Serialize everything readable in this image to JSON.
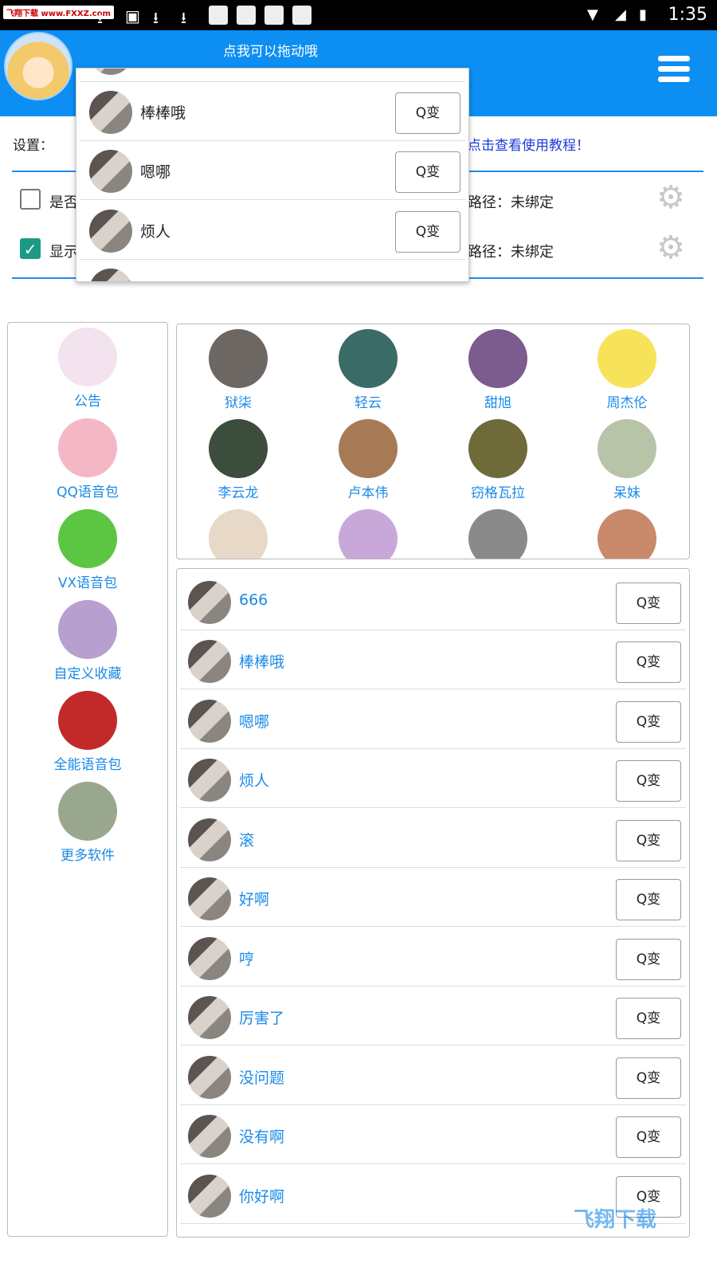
{
  "status_bar": {
    "watermark": "飞翔下载 www.FXXZ.com",
    "time": "1:35"
  },
  "header": {
    "hint": "点我可以拖动哦"
  },
  "settings": {
    "label": "设置：",
    "tutorial_link": "点击查看使用教程！",
    "row1": {
      "label": "是否",
      "path": "路径：未绑定",
      "checked": false
    },
    "row2": {
      "label": "显示",
      "path": "路径：未绑定",
      "checked": true
    }
  },
  "popup": {
    "items": [
      {
        "name": "棒棒哦",
        "button": "Q变"
      },
      {
        "name": "嗯哪",
        "button": "Q变"
      },
      {
        "name": "烦人",
        "button": "Q变"
      }
    ]
  },
  "categories": [
    {
      "label": "公告",
      "color": "#f3e3ee"
    },
    {
      "label": "QQ语音包",
      "color": "#f4b7c6"
    },
    {
      "label": "VX语音包",
      "color": "#5cc642"
    },
    {
      "label": "自定义收藏",
      "color": "#b7a0cf"
    },
    {
      "label": "全能语音包",
      "color": "#c22a2a"
    },
    {
      "label": "更多软件",
      "color": "#9aa78f"
    }
  ],
  "celebrities": [
    {
      "label": "狱柒",
      "color": "#6d6764"
    },
    {
      "label": "轻云",
      "color": "#3b6b66"
    },
    {
      "label": "甜旭",
      "color": "#7c5b8f"
    },
    {
      "label": "周杰伦",
      "color": "#f6e35a"
    },
    {
      "label": "李云龙",
      "color": "#3d4d3d"
    },
    {
      "label": "卢本伟",
      "color": "#a57a55"
    },
    {
      "label": "窃格瓦拉",
      "color": "#6f6a3a"
    },
    {
      "label": "呆妹",
      "color": "#b8c4a8"
    },
    {
      "label": "",
      "color": "#e8d8c8"
    },
    {
      "label": "",
      "color": "#c8a8d8"
    },
    {
      "label": "",
      "color": "#8a8a8a"
    },
    {
      "label": "",
      "color": "#c88a6a"
    }
  ],
  "voice_list": [
    {
      "name": "666",
      "button": "Q变"
    },
    {
      "name": "棒棒哦",
      "button": "Q变"
    },
    {
      "name": "嗯哪",
      "button": "Q变"
    },
    {
      "name": "烦人",
      "button": "Q变"
    },
    {
      "name": "滚",
      "button": "Q变"
    },
    {
      "name": "好啊",
      "button": "Q变"
    },
    {
      "name": "哼",
      "button": "Q变"
    },
    {
      "name": "厉害了",
      "button": "Q变"
    },
    {
      "name": "没问题",
      "button": "Q变"
    },
    {
      "name": "没有啊",
      "button": "Q变"
    },
    {
      "name": "你好啊",
      "button": "Q变"
    }
  ],
  "footer_watermark": "飞翔下载"
}
